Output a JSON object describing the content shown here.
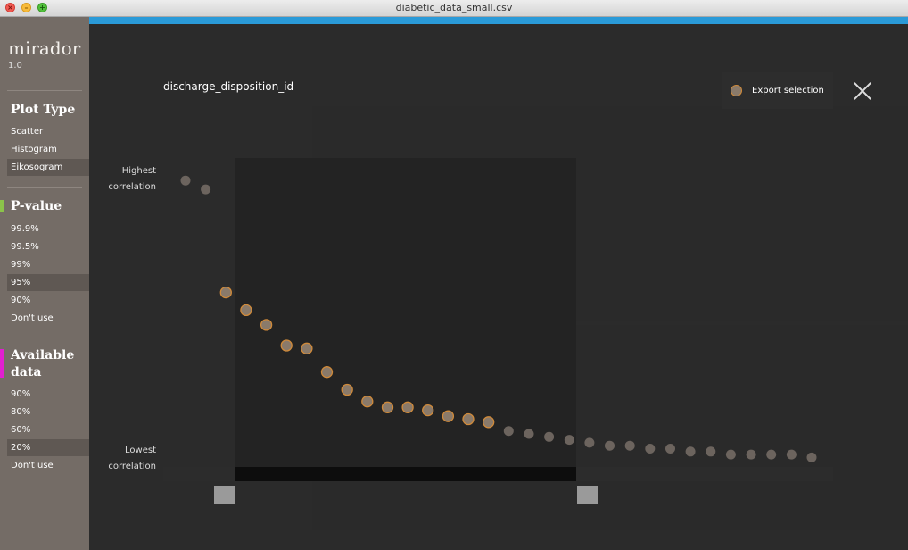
{
  "window": {
    "title": "diabetic_data_small.csv"
  },
  "app": {
    "name": "mirador",
    "version": "1.0"
  },
  "sidebar": {
    "plot_type": {
      "title": "Plot Type",
      "items": [
        {
          "label": "Scatter",
          "selected": false
        },
        {
          "label": "Histogram",
          "selected": false
        },
        {
          "label": "Eikosogram",
          "selected": true
        }
      ]
    },
    "pvalue": {
      "title": "P-value",
      "marker_color": "#8bc34a",
      "items": [
        {
          "label": "99.9%",
          "selected": false
        },
        {
          "label": "99.5%",
          "selected": false
        },
        {
          "label": "99%",
          "selected": false
        },
        {
          "label": "95%",
          "selected": true
        },
        {
          "label": "90%",
          "selected": false
        },
        {
          "label": "Don't use",
          "selected": false
        }
      ]
    },
    "available": {
      "title_line1": "Available",
      "title_line2": "data",
      "marker_color": "#e01fd0",
      "items": [
        {
          "label": "90%",
          "selected": false
        },
        {
          "label": "80%",
          "selected": false
        },
        {
          "label": "60%",
          "selected": false
        },
        {
          "label": "20%",
          "selected": true
        },
        {
          "label": "Don't use",
          "selected": false
        }
      ]
    }
  },
  "dialog": {
    "title": "discharge_disposition_id",
    "export_label": "Export selection",
    "highest_line1": "Highest",
    "highest_line2": "correlation",
    "lowest_line1": "Lowest",
    "lowest_line2": "correlation"
  },
  "colors": {
    "accent_blue": "#2a9ad8",
    "selected_point_fill": "#8a7a6a",
    "selected_point_stroke": "#d08a3a",
    "unselected_point_fill": "#6c645e"
  },
  "chart_data": {
    "type": "scatter",
    "title": "discharge_disposition_id",
    "xlabel": "",
    "ylabel": "",
    "x": [
      1,
      2,
      3,
      4,
      5,
      6,
      7,
      8,
      9,
      10,
      11,
      12,
      13,
      14,
      15,
      16,
      17,
      18,
      19,
      20,
      21,
      22,
      23,
      24,
      25,
      26,
      27,
      28,
      29,
      30,
      31,
      32
    ],
    "values": [
      0.96,
      0.93,
      0.58,
      0.52,
      0.47,
      0.4,
      0.39,
      0.31,
      0.25,
      0.21,
      0.19,
      0.19,
      0.18,
      0.16,
      0.15,
      0.14,
      0.11,
      0.1,
      0.09,
      0.08,
      0.07,
      0.06,
      0.06,
      0.05,
      0.05,
      0.04,
      0.04,
      0.03,
      0.03,
      0.03,
      0.03,
      0.02
    ],
    "selected": [
      false,
      false,
      true,
      true,
      true,
      true,
      true,
      true,
      true,
      true,
      true,
      true,
      true,
      true,
      true,
      true,
      false,
      false,
      false,
      false,
      false,
      false,
      false,
      false,
      false,
      false,
      false,
      false,
      false,
      false,
      false,
      false
    ],
    "selection_range": [
      3,
      16
    ],
    "ylim": [
      0,
      1
    ]
  }
}
